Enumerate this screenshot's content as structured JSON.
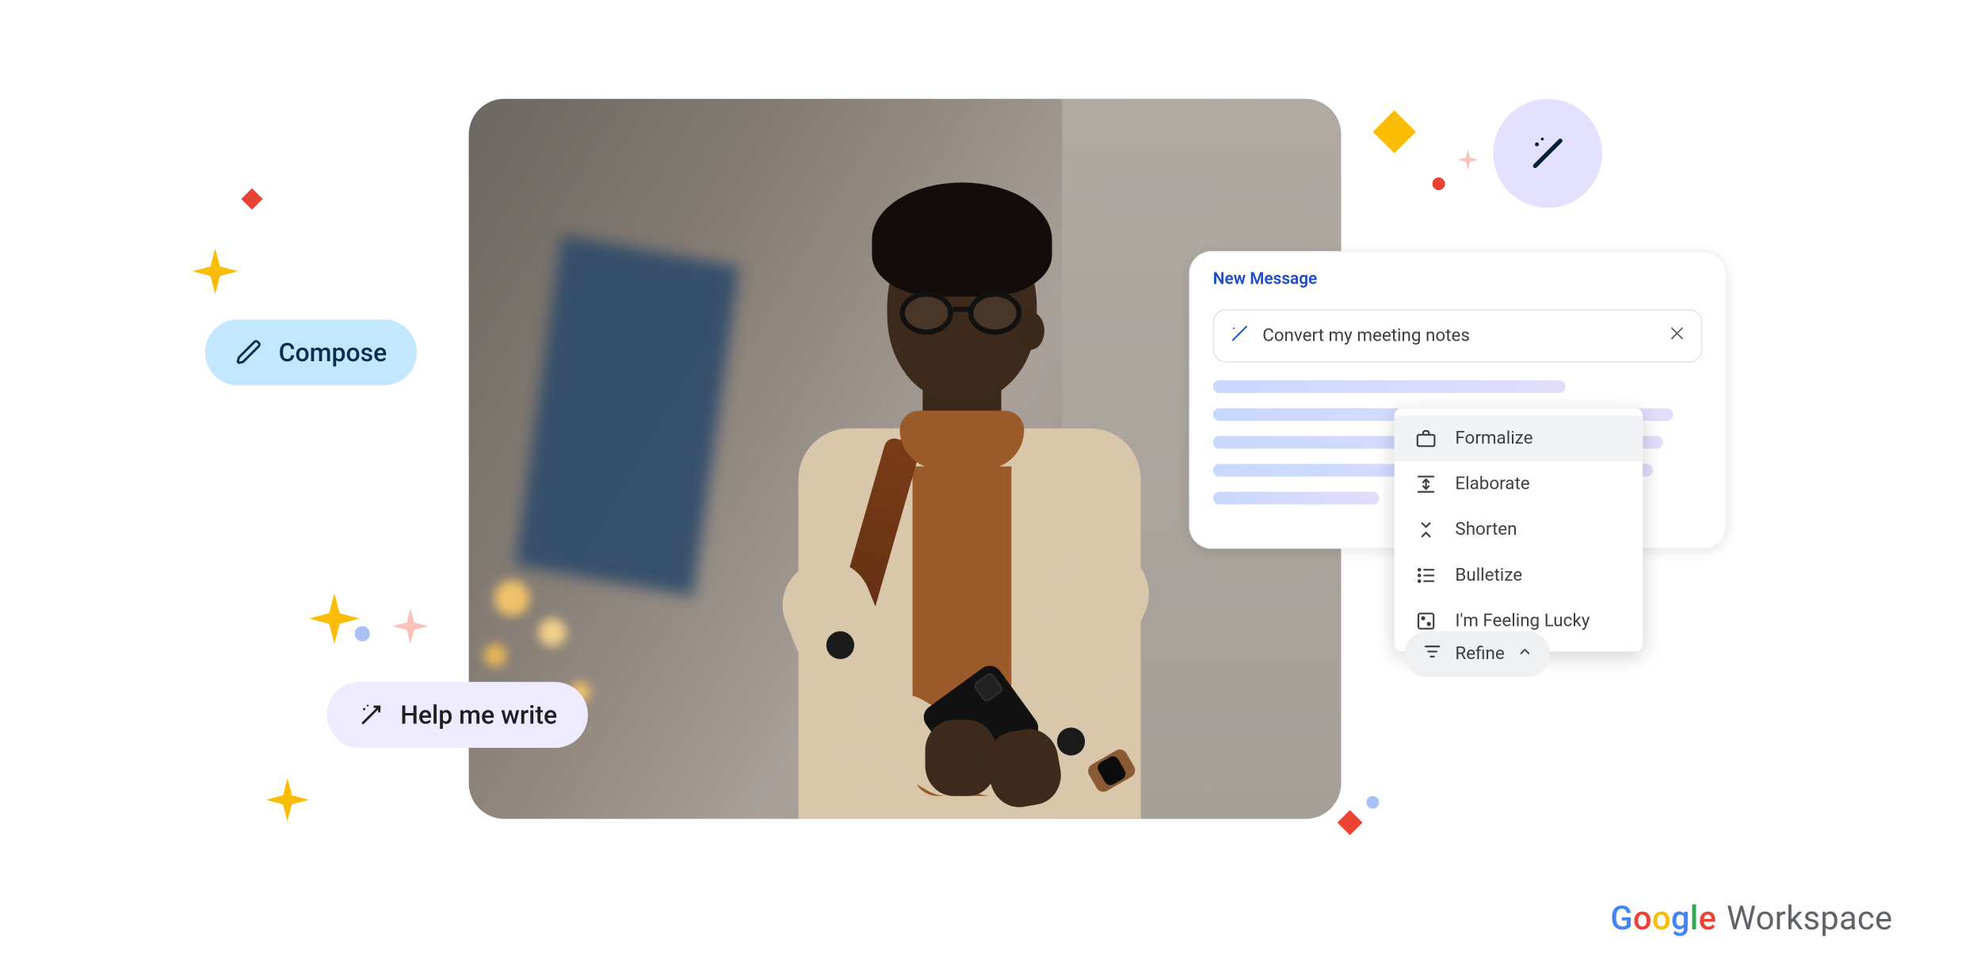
{
  "pills": {
    "compose": "Compose",
    "help_me_write": "Help me write"
  },
  "panel": {
    "title": "New Message",
    "prompt": "Convert my meeting notes"
  },
  "menu": {
    "items": [
      {
        "icon": "briefcase-icon",
        "label": "Formalize"
      },
      {
        "icon": "expand-vert-icon",
        "label": "Elaborate"
      },
      {
        "icon": "collapse-vert-icon",
        "label": "Shorten"
      },
      {
        "icon": "list-icon",
        "label": "Bulletize"
      },
      {
        "icon": "dice-icon",
        "label": "I'm Feeling Lucky"
      }
    ]
  },
  "refine": {
    "label": "Refine"
  },
  "brand": {
    "google": "Google",
    "workspace": "Workspace"
  },
  "colors": {
    "google_blue": "#4285F4",
    "google_red": "#EA4335",
    "google_yellow": "#FBBC05",
    "google_green": "#34A853",
    "pill_blue": "#c2e7ff",
    "pill_lavender": "#eeeaff",
    "magic_lavender": "#e4e0ff",
    "sparkle_yellow": "#fbbc04",
    "sparkle_pink": "#f8c3bd",
    "sparkle_red": "#ea4335",
    "sparkle_blue": "#b3c6ff"
  }
}
